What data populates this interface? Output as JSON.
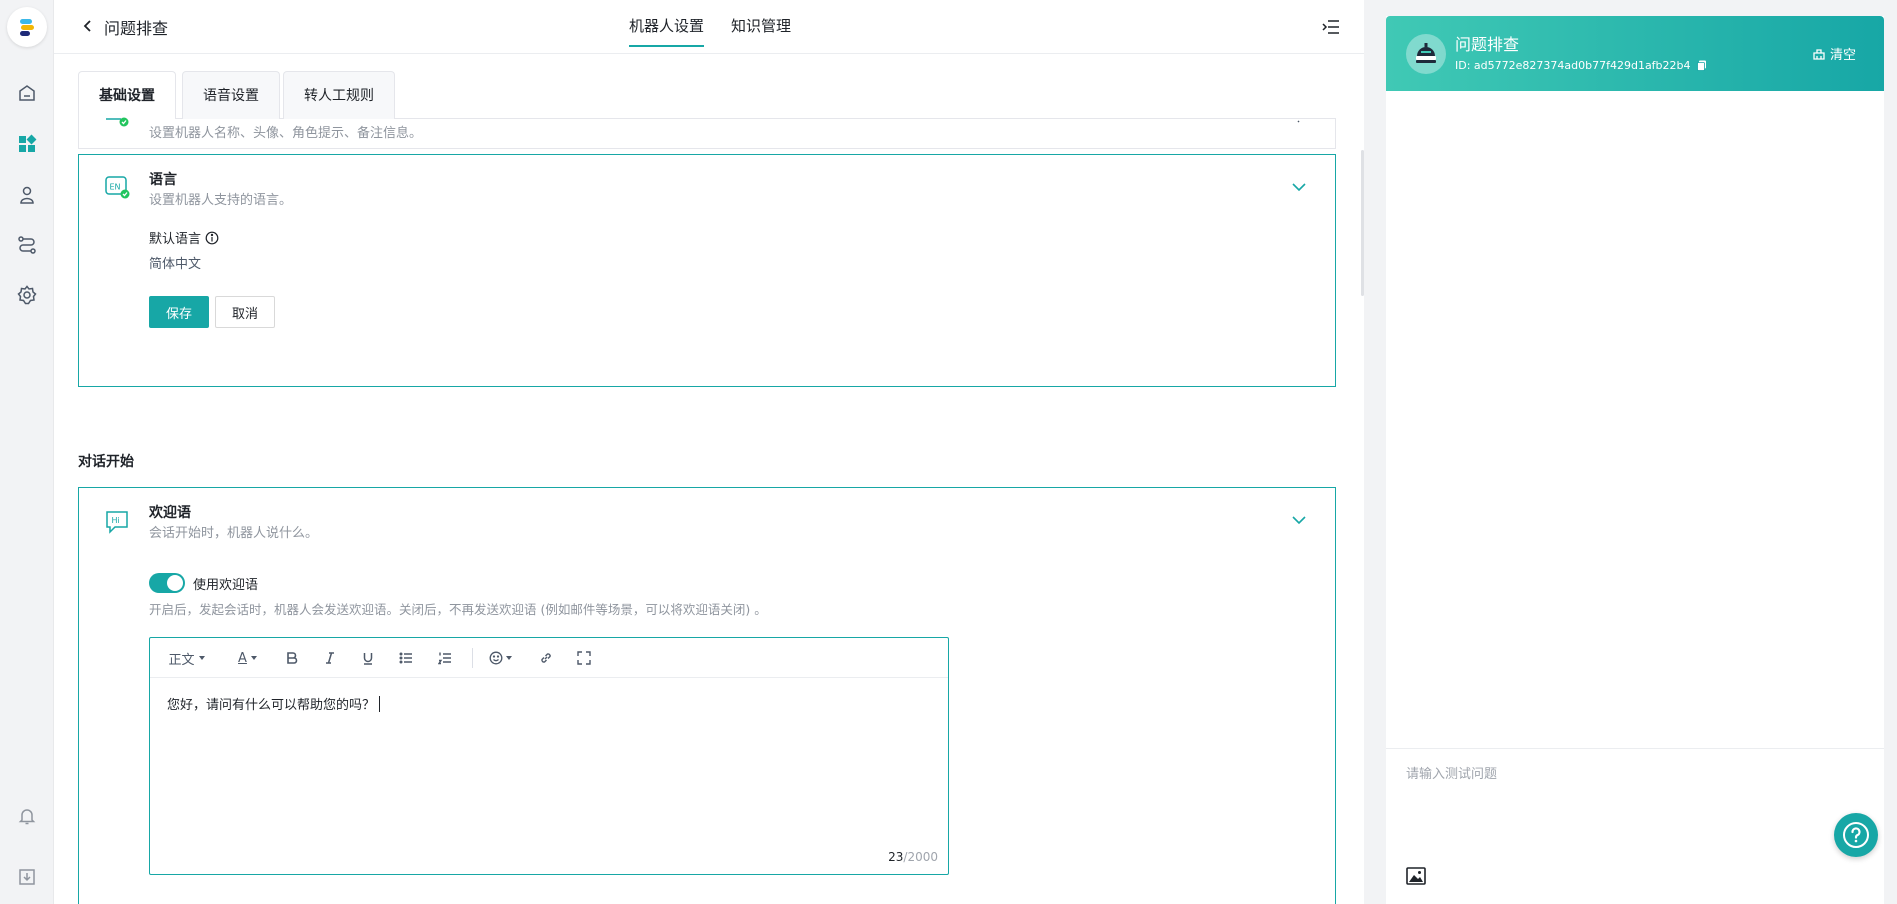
{
  "header": {
    "back_icon": "chevron-left-icon",
    "title": "问题排查",
    "tabs": [
      {
        "label": "机器人设置",
        "active": true
      },
      {
        "label": "知识管理",
        "active": false
      }
    ],
    "menu_icon": "collapse-menu-icon"
  },
  "rail": {
    "items": [
      "logo",
      "home-icon",
      "dashboard-icon",
      "user-icon",
      "flow-icon",
      "settings-icon",
      "bell-icon",
      "download-icon"
    ],
    "active": "dashboard-icon"
  },
  "subtabs": [
    {
      "label": "基础设置",
      "active": true
    },
    {
      "label": "语音设置",
      "active": false
    },
    {
      "label": "转人工规则",
      "active": false
    }
  ],
  "profile_card": {
    "desc": "设置机器人名称、头像、角色提示、备注信息。"
  },
  "language_card": {
    "icon": "language-en-icon",
    "title": "语言",
    "desc": "设置机器人支持的语言。",
    "field_label": "默认语言",
    "field_value": "简体中文",
    "save_label": "保存",
    "cancel_label": "取消"
  },
  "section": {
    "dialog_start": "对话开始"
  },
  "welcome_card": {
    "icon": "hi-chat-icon",
    "title": "欢迎语",
    "desc": "会话开始时，机器人说什么。",
    "toggle_label": "使用欢迎语",
    "toggle_on": true,
    "hint": "开启后，发起会话时，机器人会发送欢迎语。关闭后，不再发送欢迎语 (例如邮件等场景，可以将欢迎语关闭) 。",
    "editor": {
      "toolbar": {
        "paragraph": "正文",
        "font_color": "A"
      },
      "content": "您好，请问有什么可以帮助您的吗？",
      "count": "23",
      "max": "/2000"
    }
  },
  "chat_panel": {
    "bot_name": "问题排查",
    "bot_id": "ID: ad5772e827374ad0b77f429d1afb22b4",
    "clear_label": "清空",
    "input_placeholder": "请输入测试问题"
  },
  "colors": {
    "accent": "#17a7a6",
    "accent_light": "#40c9b5",
    "text": "#1f2329",
    "muted": "#8f959e"
  }
}
